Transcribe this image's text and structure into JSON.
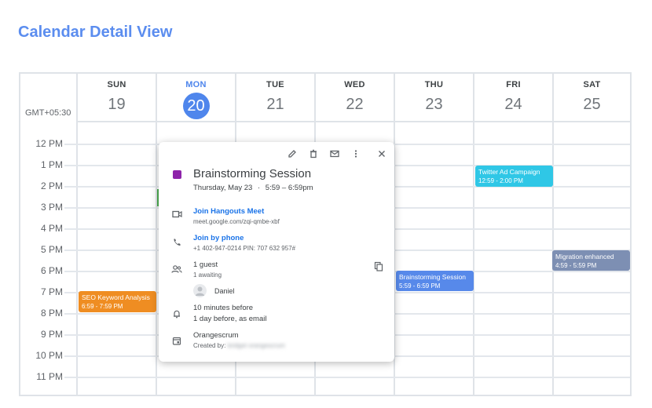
{
  "page": {
    "title": "Calendar Detail View"
  },
  "calendar": {
    "timezone": "GMT+05:30",
    "days": [
      {
        "name": "SUN",
        "num": "19"
      },
      {
        "name": "MON",
        "num": "20"
      },
      {
        "name": "TUE",
        "num": "21"
      },
      {
        "name": "WED",
        "num": "22"
      },
      {
        "name": "THU",
        "num": "23"
      },
      {
        "name": "FRI",
        "num": "24"
      },
      {
        "name": "SAT",
        "num": "25"
      }
    ],
    "times": [
      "12 PM",
      "1 PM",
      "2 PM",
      "3 PM",
      "4 PM",
      "5 PM",
      "6 PM",
      "7 PM",
      "8 PM",
      "9 PM",
      "10 PM",
      "11 PM"
    ],
    "events": [
      {
        "title": "SEO Keyword Analysis",
        "time": "6:59 - 7:59 PM",
        "color": "#ef8d22"
      },
      {
        "title": "Twitter Ad Campaign",
        "time": "12:59 - 2:00 PM",
        "color": "#2fc7e6"
      },
      {
        "title": "Brainstorming Session",
        "time": "5:59 - 6:59 PM",
        "color": "#5789ea"
      },
      {
        "title": "Migration enhanced",
        "time": "4:59 - 5:59 PM",
        "color": "#7d8fb3"
      }
    ]
  },
  "popup": {
    "title": "Brainstorming Session",
    "date": "Thursday, May 23",
    "separator": "·",
    "time": "5:59 – 6:59pm",
    "event_color": "#8e24aa",
    "meet_label": "Join Hangouts Meet",
    "meet_link": "meet.google.com/zqi-qmbe-xbf",
    "phone_label": "Join by phone",
    "phone_details": "+1 402-947-0214 PIN: 707 632 957#",
    "guests_count": "1 guest",
    "guests_status": "1 awaiting",
    "guest_name": "Daniel",
    "reminder_1": "10 minutes before",
    "reminder_2": "1 day before, as email",
    "calendar_name": "Orangescrum",
    "created_by_label": "Created by:",
    "created_by_value": "bridget orangescrum"
  }
}
